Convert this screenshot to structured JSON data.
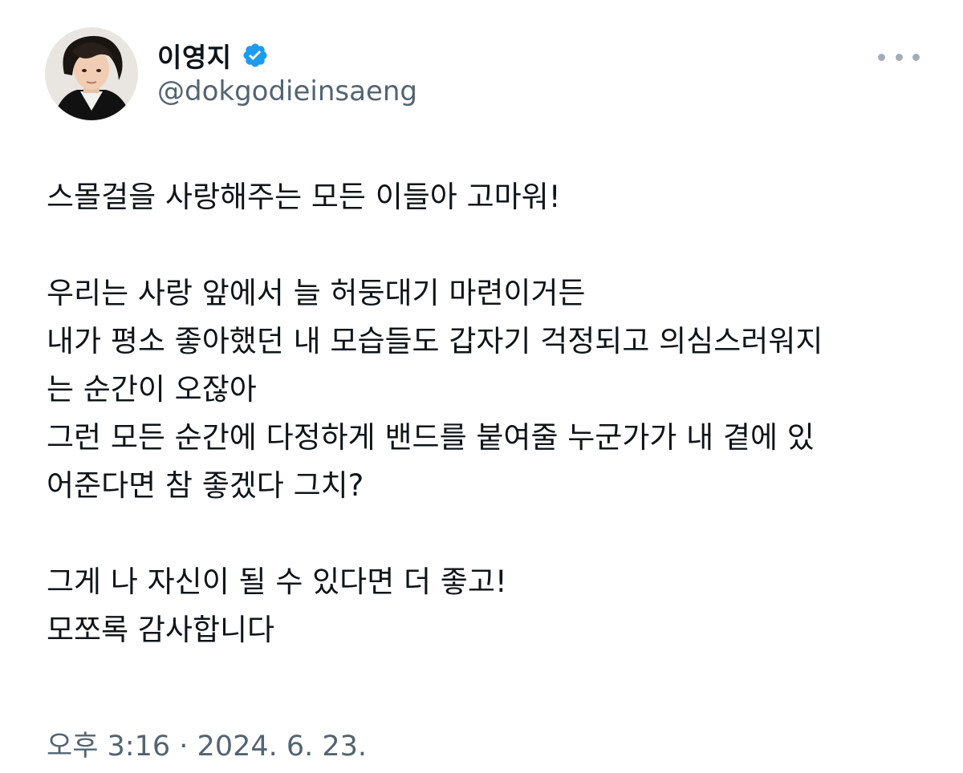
{
  "author": {
    "display_name": "이영지",
    "handle": "@dokgodieinsaeng",
    "verified": true,
    "verified_color": "#1d9bf0"
  },
  "tweet": {
    "paragraphs": [
      [
        "스몰걸을 사랑해주는 모든 이들아 고마워!"
      ],
      [
        "우리는 사랑 앞에서 늘 허둥대기 마련이거든",
        "내가 평소 좋아했던 내 모습들도 갑자기 걱정되고 의심스러워지",
        "는 순간이 오잖아",
        "그런 모든 순간에 다정하게 밴드를 붙여줄 누군가가 내 곁에 있",
        "어준다면 참 좋겠다 그치?"
      ],
      [
        "그게 나 자신이 될 수 있다면 더 좋고!",
        "모쪼록 감사합니다"
      ]
    ]
  },
  "meta": {
    "time": "오후 3:16",
    "separator": "·",
    "date": "2024. 6. 23."
  },
  "icons": {
    "more": "more-horizontal-icon",
    "verified": "verified-badge-icon"
  },
  "colors": {
    "text": "#0f1419",
    "secondary": "#536471",
    "accent": "#1d9bf0"
  }
}
